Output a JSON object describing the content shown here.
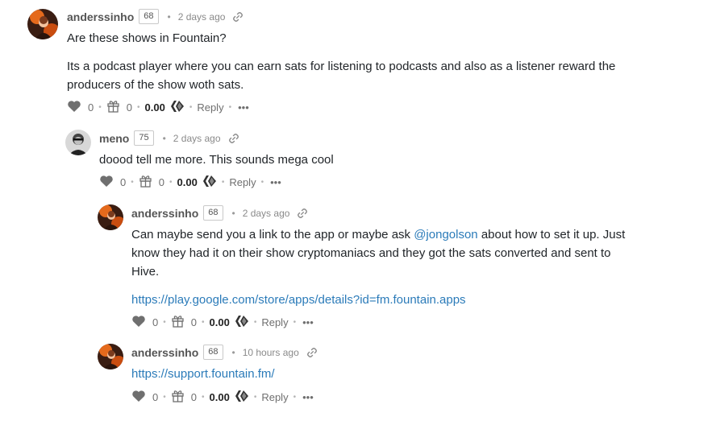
{
  "comments": [
    {
      "author": "anderssinho",
      "reputation": "68",
      "time": "2 days ago",
      "avatar": "orange-avatar",
      "paragraphs": [
        "Are these shows in Fountain?",
        "Its a podcast player where you can earn sats for listening to podcasts and also as a listener reward the producers of the show woth sats."
      ],
      "votes": "0",
      "gifts": "0",
      "payout": "0.00",
      "reply_label": "Reply",
      "more_label": "•••"
    },
    {
      "author": "meno",
      "reputation": "75",
      "time": "2 days ago",
      "avatar": "bw-avatar",
      "paragraphs": [
        "doood tell me more. This sounds mega cool"
      ],
      "votes": "0",
      "gifts": "0",
      "payout": "0.00",
      "reply_label": "Reply",
      "more_label": "•••"
    },
    {
      "author": "anderssinho",
      "reputation": "68",
      "time": "2 days ago",
      "avatar": "orange-avatar",
      "text_before_mention": "Can maybe send you a link to the app or maybe ask ",
      "mention": "@jongolson",
      "text_after_mention": " about how to set it up. Just know they had it on their show cryptomaniacs and they got the sats converted and sent to Hive.",
      "link": "https://play.google.com/store/apps/details?id=fm.fountain.apps",
      "votes": "0",
      "gifts": "0",
      "payout": "0.00",
      "reply_label": "Reply",
      "more_label": "•••"
    },
    {
      "author": "anderssinho",
      "reputation": "68",
      "time": "10 hours ago",
      "avatar": "orange-avatar",
      "link": "https://support.fountain.fm/",
      "votes": "0",
      "gifts": "0",
      "payout": "0.00",
      "reply_label": "Reply",
      "more_label": "•••"
    }
  ],
  "colors": {
    "link": "#2b7bb9",
    "text": "#212529",
    "muted": "#8a8a8a",
    "icon": "#6f6f6f"
  }
}
